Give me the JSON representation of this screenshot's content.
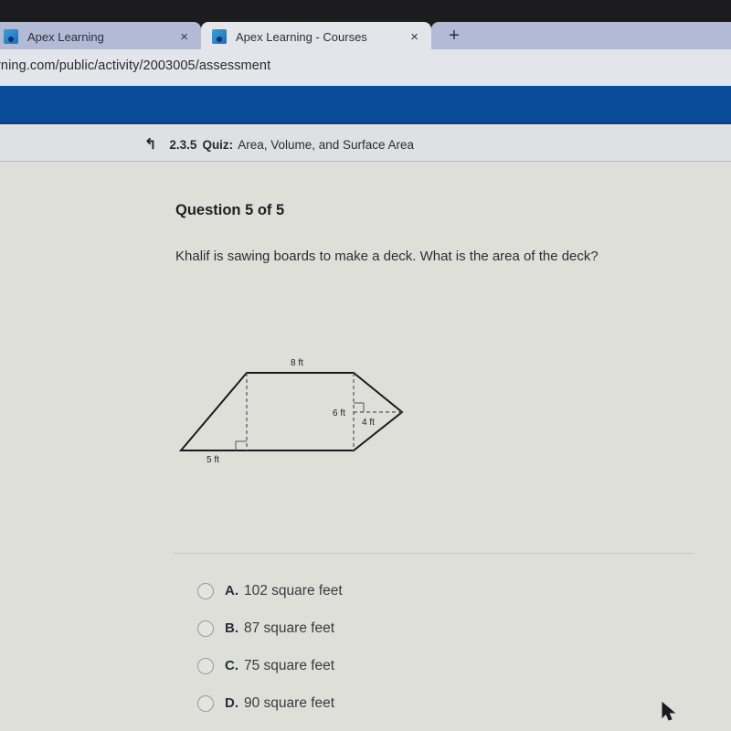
{
  "browser": {
    "tabs": [
      {
        "label": "Apex Learning",
        "active": false,
        "close": "×"
      },
      {
        "label": "Apex Learning - Courses",
        "active": true,
        "close": "×"
      }
    ],
    "new_tab": "+",
    "url": "rning.com/public/activity/2003005/assessment"
  },
  "breadcrumb": {
    "icon": "up-arrow-icon",
    "up_glyph": "↰",
    "code": "2.3.5",
    "kind": "Quiz:",
    "title": "Area, Volume, and Surface Area"
  },
  "question": {
    "number_label": "Question 5 of 5",
    "text": "Khalif is sawing boards to make a deck. What is the area of the deck?",
    "figure": {
      "labels": {
        "top": "8 ft",
        "height": "6 ft",
        "triangle_height": "4 ft",
        "bottom_offset": "5 ft"
      }
    }
  },
  "options": [
    {
      "letter": "A.",
      "text": "102 square feet"
    },
    {
      "letter": "B.",
      "text": "87 square feet"
    },
    {
      "letter": "C.",
      "text": "75 square feet"
    },
    {
      "letter": "D.",
      "text": "90 square feet"
    }
  ]
}
